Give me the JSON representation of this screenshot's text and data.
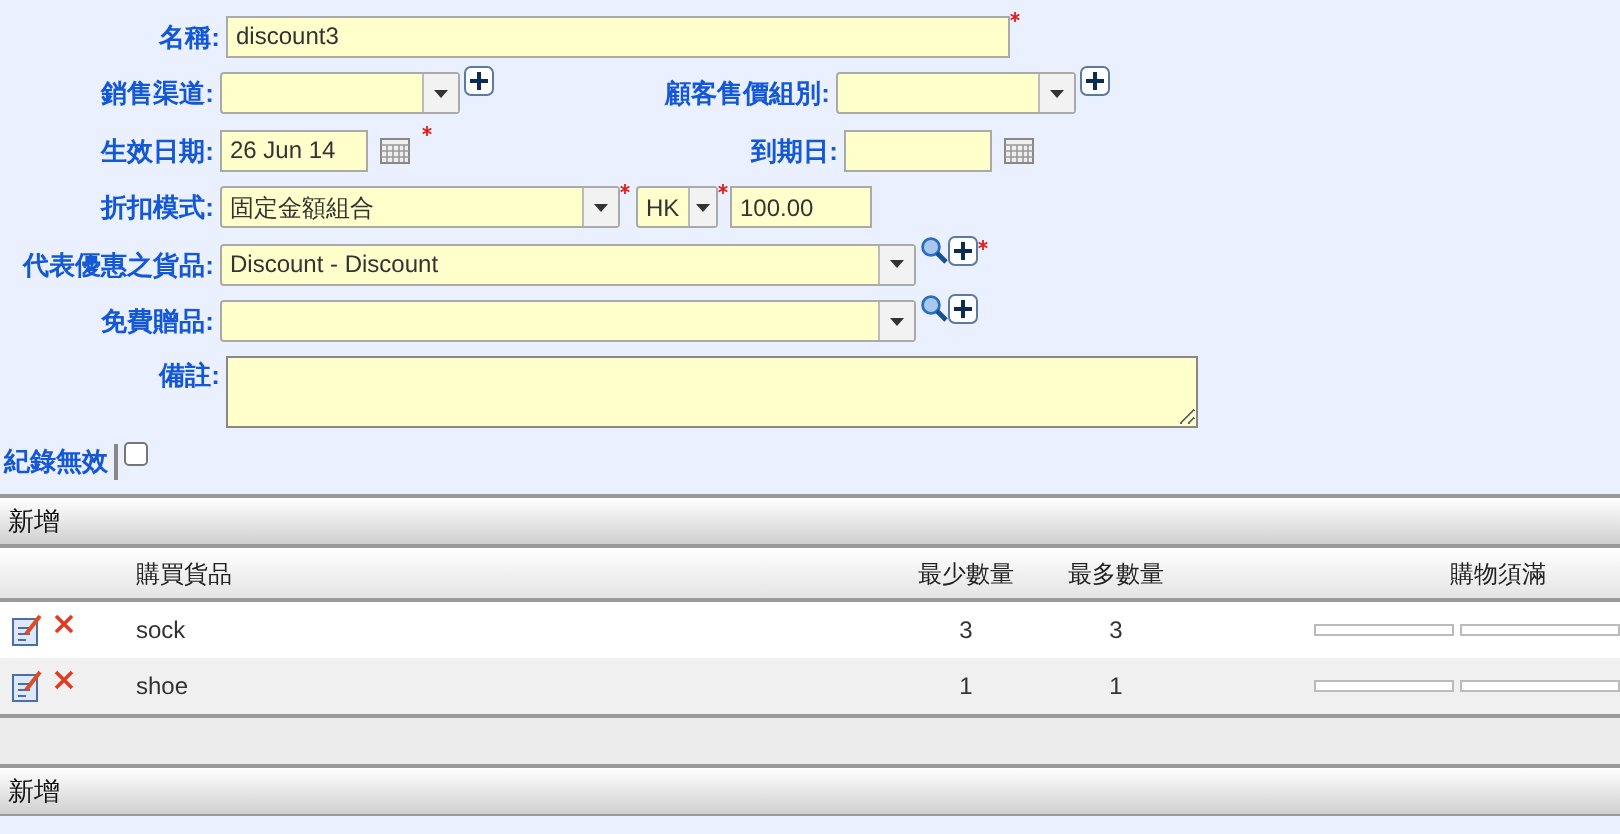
{
  "form": {
    "name": {
      "label": "名稱:",
      "value": "discount3",
      "required": true
    },
    "sales_channel": {
      "label": "銷售渠道:"
    },
    "customer_price_group": {
      "label": "顧客售價組別:"
    },
    "start_date": {
      "label": "生效日期:",
      "value": "26 Jun 14",
      "required": true
    },
    "end_date": {
      "label": "到期日:"
    },
    "discount_mode": {
      "label": "折扣模式:",
      "value": "固定金額組合",
      "required": true,
      "currency": "HK",
      "currency_required": true,
      "amount": "100.00"
    },
    "discount_item": {
      "label": "代表優惠之貨品:",
      "value": "Discount - Discount",
      "required": true
    },
    "free_gift": {
      "label": "免費贈品:"
    },
    "remarks": {
      "label": "備註:"
    },
    "invalid_record": {
      "label": "紀錄無效",
      "checked": false
    }
  },
  "sections": [
    {
      "title": "新增",
      "columns": [
        "購買貨品",
        "最少數量",
        "最多數量",
        "購物須滿"
      ],
      "rows": [
        {
          "item": "sock",
          "min": "3",
          "max": "3"
        },
        {
          "item": "shoe",
          "min": "1",
          "max": "1"
        }
      ]
    },
    {
      "title": "新增"
    }
  ]
}
